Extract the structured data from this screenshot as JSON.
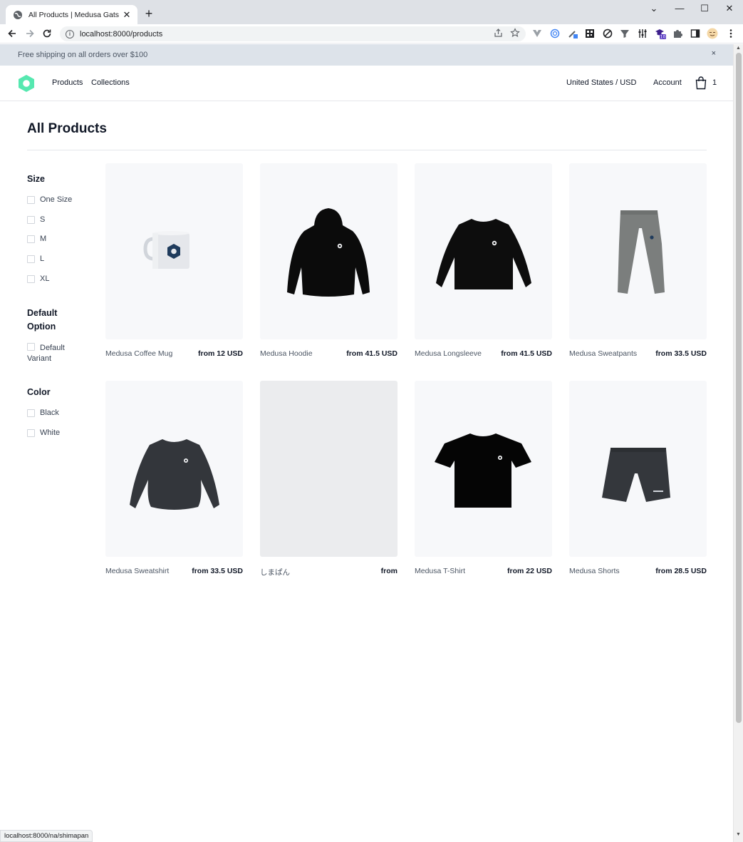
{
  "browser": {
    "tab_title": "All Products | Medusa Gatsby Sta",
    "url": "localhost:8000/products",
    "status_url": "localhost:8000/na/shimapan",
    "extension_badge": "10"
  },
  "banner": {
    "text": "Free shipping on all orders over $100",
    "close": "×"
  },
  "header": {
    "nav": [
      "Products",
      "Collections"
    ],
    "region": "United States / USD",
    "account": "Account",
    "cart_count": "1"
  },
  "page": {
    "title": "All Products"
  },
  "filters": [
    {
      "title": "Size",
      "options": [
        "One Size",
        "S",
        "M",
        "L",
        "XL"
      ]
    },
    {
      "title": "Default Option",
      "options": [
        "Default Variant"
      ]
    },
    {
      "title": "Color",
      "options": [
        "Black",
        "White"
      ]
    }
  ],
  "products": [
    {
      "name": "Medusa Coffee Mug",
      "price": "from 12 USD",
      "image": "mug",
      "color": "#e5e7eb"
    },
    {
      "name": "Medusa Hoodie",
      "price": "from 41.5 USD",
      "image": "hoodie",
      "color": "#0b0b0b"
    },
    {
      "name": "Medusa Longsleeve",
      "price": "from 41.5 USD",
      "image": "longsleeve",
      "color": "#0d0d0d"
    },
    {
      "name": "Medusa Sweatpants",
      "price": "from 33.5 USD",
      "image": "sweatpants",
      "color": "#7b7e7d"
    },
    {
      "name": "Medusa Sweatshirt",
      "price": "from 33.5 USD",
      "image": "sweatshirt",
      "color": "#33363b"
    },
    {
      "name": "しまぱん",
      "price": "from",
      "image": "none",
      "color": ""
    },
    {
      "name": "Medusa T-Shirt",
      "price": "from 22 USD",
      "image": "tshirt",
      "color": "#050505"
    },
    {
      "name": "Medusa Shorts",
      "price": "from 28.5 USD",
      "image": "shorts",
      "color": "#34373c"
    }
  ],
  "colors": {
    "accent": "#56e8b0",
    "banner_bg": "#dde3ea",
    "card_bg": "#f7f8fa"
  }
}
